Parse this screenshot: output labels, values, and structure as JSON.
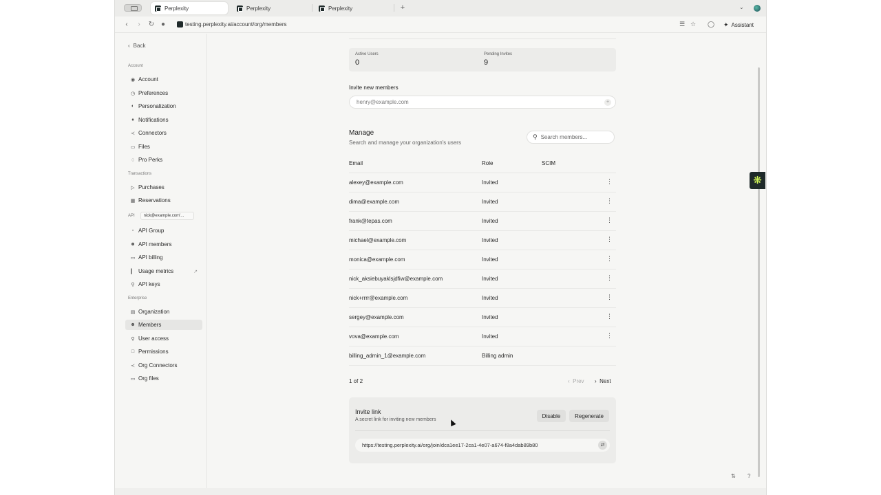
{
  "browser": {
    "tabs": [
      {
        "title": "Perplexity",
        "active": true
      },
      {
        "title": "Perplexity",
        "active": false
      },
      {
        "title": "Perplexity",
        "active": false
      }
    ],
    "new_tab": "+",
    "url": "testing.perplexity.ai/account/org/members",
    "assistant_label": "Assistant"
  },
  "sidebar": {
    "back_label": "Back",
    "sections": {
      "account": "Account",
      "transactions": "Transactions",
      "api": "API",
      "enterprise": "Enterprise"
    },
    "api_account": "nick@example.com'...",
    "items": [
      {
        "label": "Account",
        "icon": "account-circle-icon"
      },
      {
        "label": "Preferences",
        "icon": "preferences-icon"
      },
      {
        "label": "Personalization",
        "icon": "personalization-icon"
      },
      {
        "label": "Notifications",
        "icon": "bell-icon"
      },
      {
        "label": "Connectors",
        "icon": "connectors-icon"
      },
      {
        "label": "Files",
        "icon": "file-icon"
      },
      {
        "label": "Pro Perks",
        "icon": "gem-icon"
      },
      {
        "label": "Purchases",
        "icon": "tag-icon"
      },
      {
        "label": "Reservations",
        "icon": "reservations-icon"
      },
      {
        "label": "API Group",
        "icon": "api-group-icon"
      },
      {
        "label": "API members",
        "icon": "users-icon"
      },
      {
        "label": "API billing",
        "icon": "billing-icon"
      },
      {
        "label": "Usage metrics",
        "icon": "chart-icon"
      },
      {
        "label": "API keys",
        "icon": "key-icon"
      },
      {
        "label": "Organization",
        "icon": "building-icon"
      },
      {
        "label": "Members",
        "icon": "members-icon"
      },
      {
        "label": "User access",
        "icon": "user-access-icon"
      },
      {
        "label": "Permissions",
        "icon": "permissions-icon"
      },
      {
        "label": "Org Connectors",
        "icon": "org-connectors-icon"
      },
      {
        "label": "Org files",
        "icon": "org-files-icon"
      }
    ]
  },
  "stats": {
    "active_users_label": "Active Users",
    "active_users": "0",
    "pending_invites_label": "Pending Invites",
    "pending_invites": "9"
  },
  "invite": {
    "title": "Invite new members",
    "placeholder": "henry@example.com"
  },
  "manage": {
    "title": "Manage",
    "subtitle": "Search and manage your organization's users",
    "search_placeholder": "Search members..."
  },
  "table": {
    "columns": [
      "Email",
      "Role",
      "SCIM"
    ],
    "rows": [
      {
        "email": "alexey@example.com",
        "role": "Invited"
      },
      {
        "email": "dima@example.com",
        "role": "Invited"
      },
      {
        "email": "frank@tepas.com",
        "role": "Invited"
      },
      {
        "email": "michael@example.com",
        "role": "Invited"
      },
      {
        "email": "monica@example.com",
        "role": "Invited"
      },
      {
        "email": "nick_aksiebuyaklsjdfiw@example.com",
        "role": "Invited"
      },
      {
        "email": "nick+rrrr@example.com",
        "role": "Invited"
      },
      {
        "email": "sergey@example.com",
        "role": "Invited"
      },
      {
        "email": "vova@example.com",
        "role": "Invited"
      },
      {
        "email": "billing_admin_1@example.com",
        "role": "Billing admin"
      }
    ]
  },
  "pager": {
    "count": "1 of 2",
    "prev": "Prev",
    "next": "Next"
  },
  "invite_link": {
    "title": "Invite link",
    "subtitle": "A secret link for inviting new members",
    "disable": "Disable",
    "regenerate": "Regenerate",
    "url": "https://testing.perplexity.ai/org/join/dca1ee17-2ca1-4e07-a674-f8a4dab89b80"
  },
  "colors": {
    "accent_widget": "#d8ff5a",
    "dark": "#1f2a2a"
  }
}
